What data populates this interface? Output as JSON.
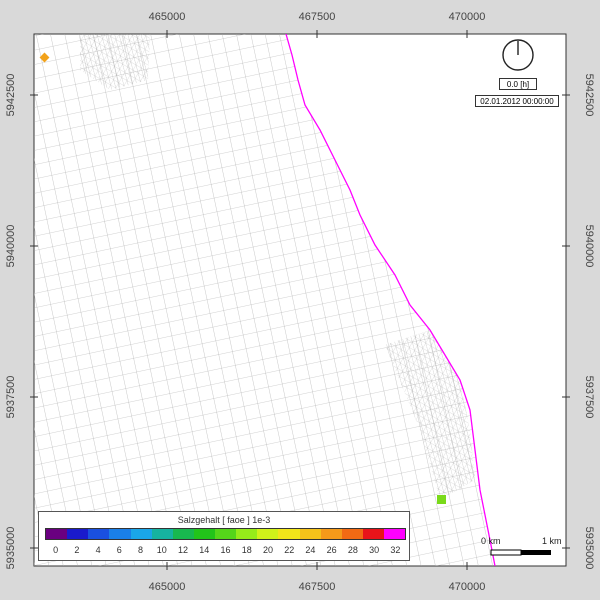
{
  "map": {
    "x_ticks": [
      "465000",
      "467500",
      "470000"
    ],
    "y_ticks": [
      "5942500",
      "5940000",
      "5937500",
      "5935000"
    ],
    "colors": {
      "coastline": "#ff00ff",
      "mesh": "#9a9a9a",
      "background": "#d9d9d9"
    }
  },
  "clock": {
    "time_label": "0.0 [h]",
    "date_label": "02.01.2012 00:00:00"
  },
  "legend": {
    "title": "Salzgehalt [ faoe ] 1e-3",
    "labels": [
      "0",
      "2",
      "4",
      "6",
      "8",
      "10",
      "12",
      "14",
      "16",
      "18",
      "20",
      "22",
      "24",
      "26",
      "28",
      "30",
      "32"
    ],
    "colors": [
      "#6a0080",
      "#1a1acc",
      "#1a50e0",
      "#1a7fe8",
      "#1aa6e8",
      "#16b3a0",
      "#18b84f",
      "#22c41a",
      "#55d61a",
      "#96ec1a",
      "#d0f21a",
      "#f2e61a",
      "#f5c21a",
      "#f59a1a",
      "#f26a14",
      "#e8141a",
      "#ff00ff"
    ]
  },
  "scale": {
    "start_label": "0 km",
    "end_label": "1 km"
  },
  "markers": [
    {
      "name": "orange-marker",
      "color": "#f2a21a"
    },
    {
      "name": "green-marker",
      "color": "#7ada1a"
    }
  ]
}
